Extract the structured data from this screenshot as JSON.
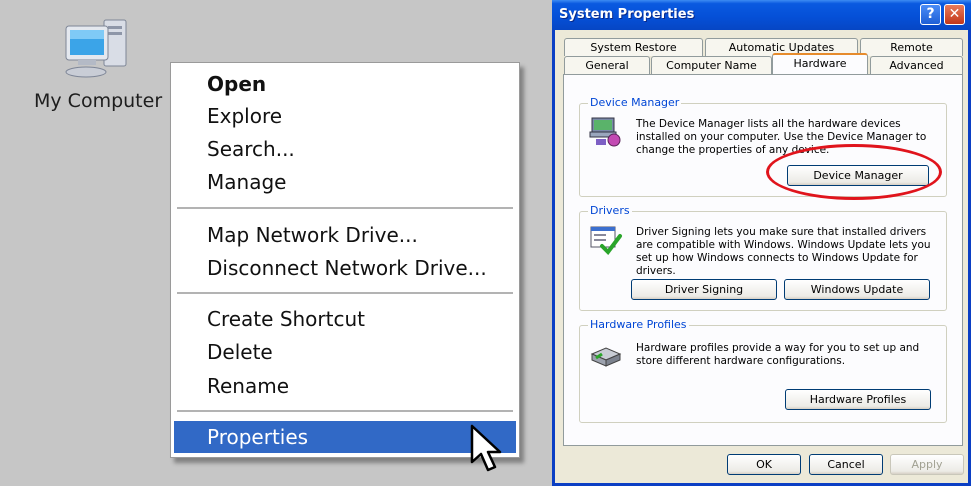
{
  "desktop": {
    "icon_label": "My Computer"
  },
  "context_menu": {
    "items": [
      {
        "label": "Open"
      },
      {
        "label": "Explore"
      },
      {
        "label": "Search..."
      },
      {
        "label": "Manage"
      },
      {
        "label": "Map Network Drive..."
      },
      {
        "label": "Disconnect Network Drive..."
      },
      {
        "label": "Create Shortcut"
      },
      {
        "label": "Delete"
      },
      {
        "label": "Rename"
      },
      {
        "label": "Properties"
      }
    ],
    "selected": "Properties"
  },
  "dialog": {
    "title": "System Properties",
    "help_glyph": "?",
    "close_glyph": "✕",
    "tabs_back": [
      "System Restore",
      "Automatic Updates",
      "Remote"
    ],
    "tabs_front": [
      "General",
      "Computer Name",
      "Hardware",
      "Advanced"
    ],
    "active_tab": "Hardware",
    "groups": {
      "device_manager": {
        "label": "Device Manager",
        "text": "The Device Manager lists all the hardware devices installed on your computer. Use the Device Manager to change the properties of any device.",
        "button": "Device Manager"
      },
      "drivers": {
        "label": "Drivers",
        "text": "Driver Signing lets you make sure that installed drivers are compatible with Windows. Windows Update lets you set up how Windows connects to Windows Update for drivers.",
        "button_signing": "Driver Signing",
        "button_update": "Windows Update"
      },
      "hardware_profiles": {
        "label": "Hardware Profiles",
        "text": "Hardware profiles provide a way for you to set up and store different hardware configurations.",
        "button": "Hardware Profiles"
      }
    },
    "buttons": {
      "ok": "OK",
      "cancel": "Cancel",
      "apply": "Apply"
    },
    "colors": {
      "title_bar": "#0550d8",
      "highlight": "#3169c6",
      "annotation_ring": "#e0141c"
    }
  }
}
